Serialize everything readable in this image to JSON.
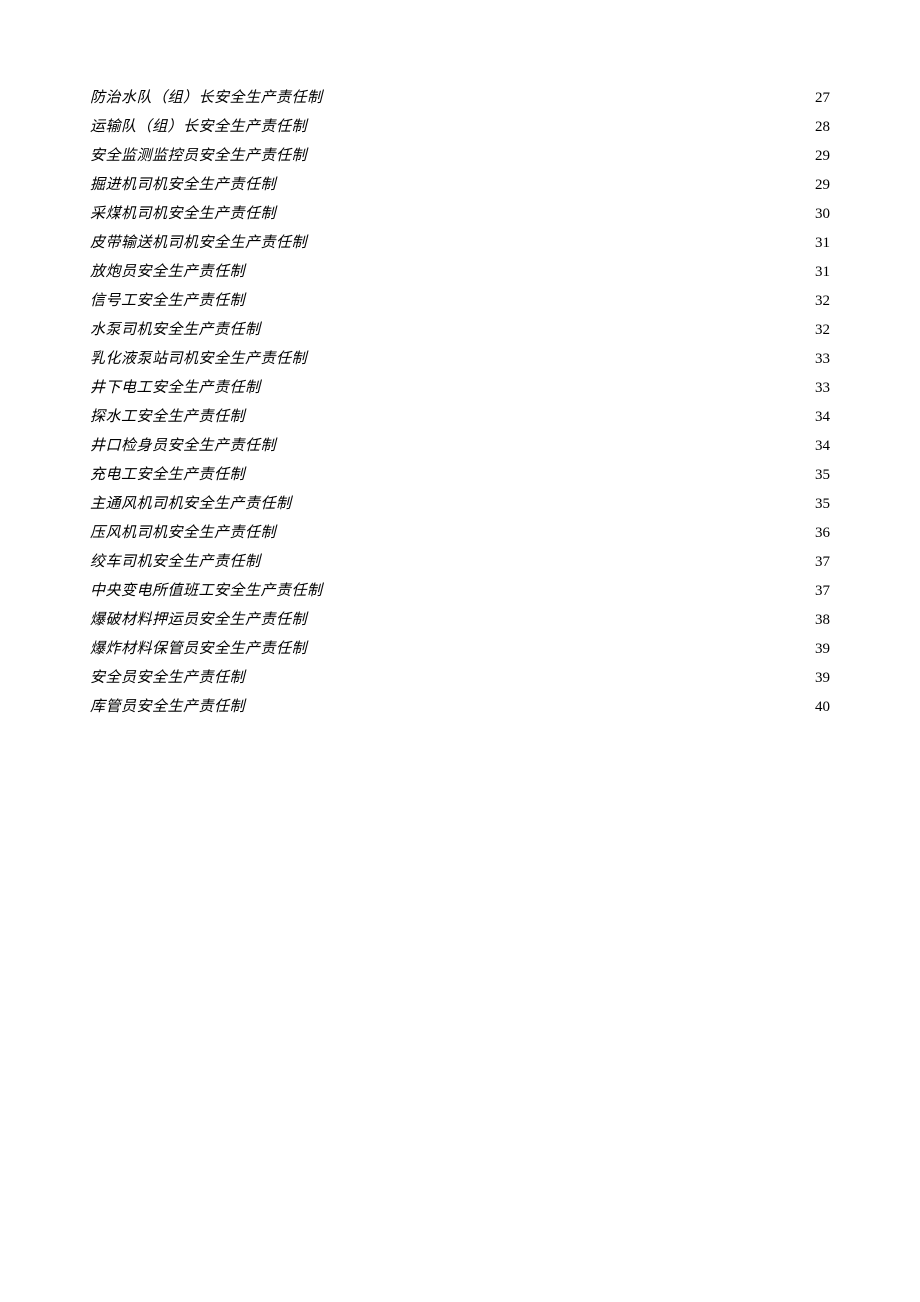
{
  "toc": {
    "entries": [
      {
        "title": "防治水队（组）长安全生产责任制",
        "page": "27"
      },
      {
        "title": "运输队（组）长安全生产责任制",
        "page": "28"
      },
      {
        "title": "安全监测监控员安全生产责任制",
        "page": "29"
      },
      {
        "title": "掘进机司机安全生产责任制",
        "page": "29"
      },
      {
        "title": "采煤机司机安全生产责任制",
        "page": "30"
      },
      {
        "title": "皮带输送机司机安全生产责任制",
        "page": "31"
      },
      {
        "title": "放炮员安全生产责任制",
        "page": "31"
      },
      {
        "title": "信号工安全生产责任制",
        "page": "32"
      },
      {
        "title": "水泵司机安全生产责任制",
        "page": "32"
      },
      {
        "title": "乳化液泵站司机安全生产责任制",
        "page": "33"
      },
      {
        "title": "井下电工安全生产责任制",
        "page": "33"
      },
      {
        "title": "探水工安全生产责任制",
        "page": "34"
      },
      {
        "title": "井口检身员安全生产责任制",
        "page": "34"
      },
      {
        "title": "充电工安全生产责任制",
        "page": "35"
      },
      {
        "title": "主通风机司机安全生产责任制",
        "page": "35"
      },
      {
        "title": "压风机司机安全生产责任制",
        "page": "36"
      },
      {
        "title": "绞车司机安全生产责任制",
        "page": "37"
      },
      {
        "title": "中央变电所值班工安全生产责任制",
        "page": "37"
      },
      {
        "title": "爆破材料押运员安全生产责任制",
        "page": "38"
      },
      {
        "title": "爆炸材料保管员安全生产责任制",
        "page": "39"
      },
      {
        "title": "安全员安全生产责任制",
        "page": "39"
      },
      {
        "title": "库管员安全生产责任制",
        "page": "40"
      }
    ]
  }
}
